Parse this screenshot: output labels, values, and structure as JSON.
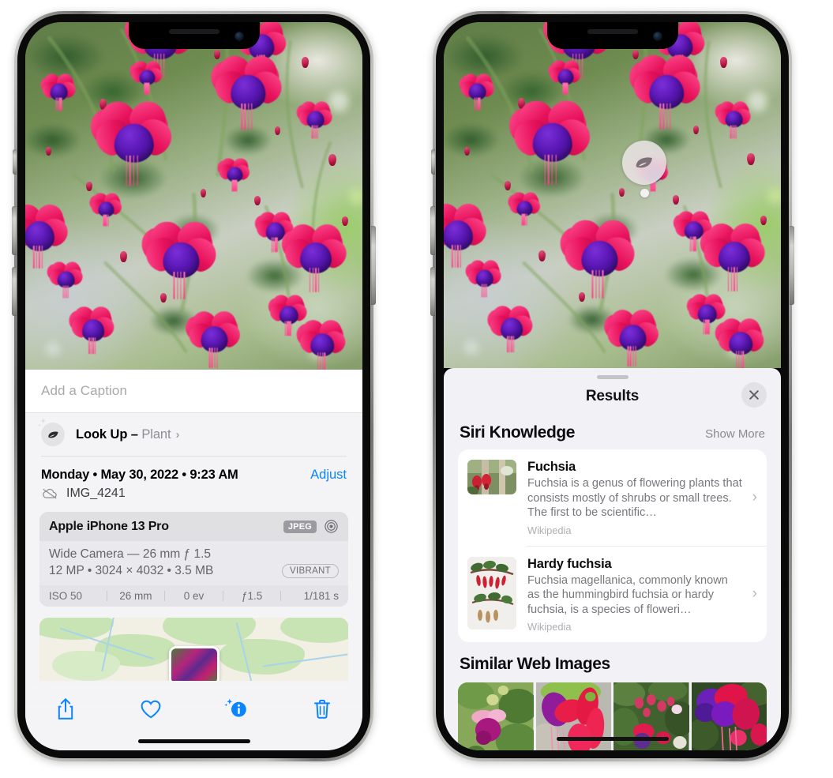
{
  "app": "ios-photos-visual-lookup",
  "left_phone": {
    "name": "photo-detail-screen",
    "caption": {
      "placeholder": "Add a Caption",
      "value": ""
    },
    "lookup": {
      "icon": "leaf-icon",
      "sparkle_icon": "sparkle-icon",
      "label": "Look Up",
      "dash": " – ",
      "subject": "Plant",
      "chevron": "›"
    },
    "meta": {
      "date": "Monday • May 30, 2022 • 9:23 AM",
      "adjust_label": "Adjust",
      "cloud_icon": "icloud-slash-icon",
      "filename": "IMG_4241"
    },
    "exif": {
      "device": "Apple iPhone 13 Pro",
      "format_badge": "JPEG",
      "raw_icon": "aperture-icon",
      "lens": "Wide Camera — 26 mm ƒ 1.5",
      "specs": "12 MP • 3024 × 4032 • 3.5 MB",
      "style_badge": "VIBRANT",
      "stats": [
        "ISO 50",
        "26 mm",
        "0 ev",
        "ƒ1.5",
        "1/181 s"
      ]
    },
    "map": {
      "name": "location-map-preview",
      "pin": "photo-pin"
    },
    "toolbar": [
      {
        "name": "share-button",
        "icon": "share-icon"
      },
      {
        "name": "favorite-button",
        "icon": "heart-icon"
      },
      {
        "name": "info-button",
        "icon": "info-sparkle-icon",
        "active": true
      },
      {
        "name": "delete-button",
        "icon": "trash-icon"
      }
    ]
  },
  "right_phone": {
    "name": "visual-lookup-results-screen",
    "photo_badge": {
      "icon": "leaf-icon",
      "name": "visual-lookup-badge"
    },
    "sheet": {
      "grabber": "drag-handle",
      "title": "Results",
      "close_icon": "close-icon"
    },
    "siri_knowledge": {
      "title": "Siri Knowledge",
      "show_more": "Show More",
      "items": [
        {
          "title": "Fuchsia",
          "description": "Fuchsia is a genus of flowering plants that consists mostly of shrubs or small trees. The first to be scientific…",
          "source": "Wikipedia",
          "thumb": "fuchsia-red-flowers-thumb",
          "chevron": "›"
        },
        {
          "title": "Hardy fuchsia",
          "description": "Fuchsia magellanica, commonly known as the hummingbird fuchsia or hardy fuchsia, is a species of floweri…",
          "source": "Wikipedia",
          "thumb": "hardy-fuchsia-specimen-thumb",
          "chevron": "›"
        }
      ]
    },
    "similar_web_images": {
      "title": "Similar Web Images",
      "items": [
        {
          "name": "web-image-1"
        },
        {
          "name": "web-image-2"
        },
        {
          "name": "web-image-3"
        },
        {
          "name": "web-image-4"
        }
      ]
    }
  },
  "colors": {
    "accent_blue": "#0a84ff",
    "sheet_bg": "#f4f4f6",
    "results_bg": "#f2f1f5",
    "card_bg": "#ffffff",
    "secondary_text": "#8e8e93",
    "exif_card": "#e6e6e9"
  }
}
